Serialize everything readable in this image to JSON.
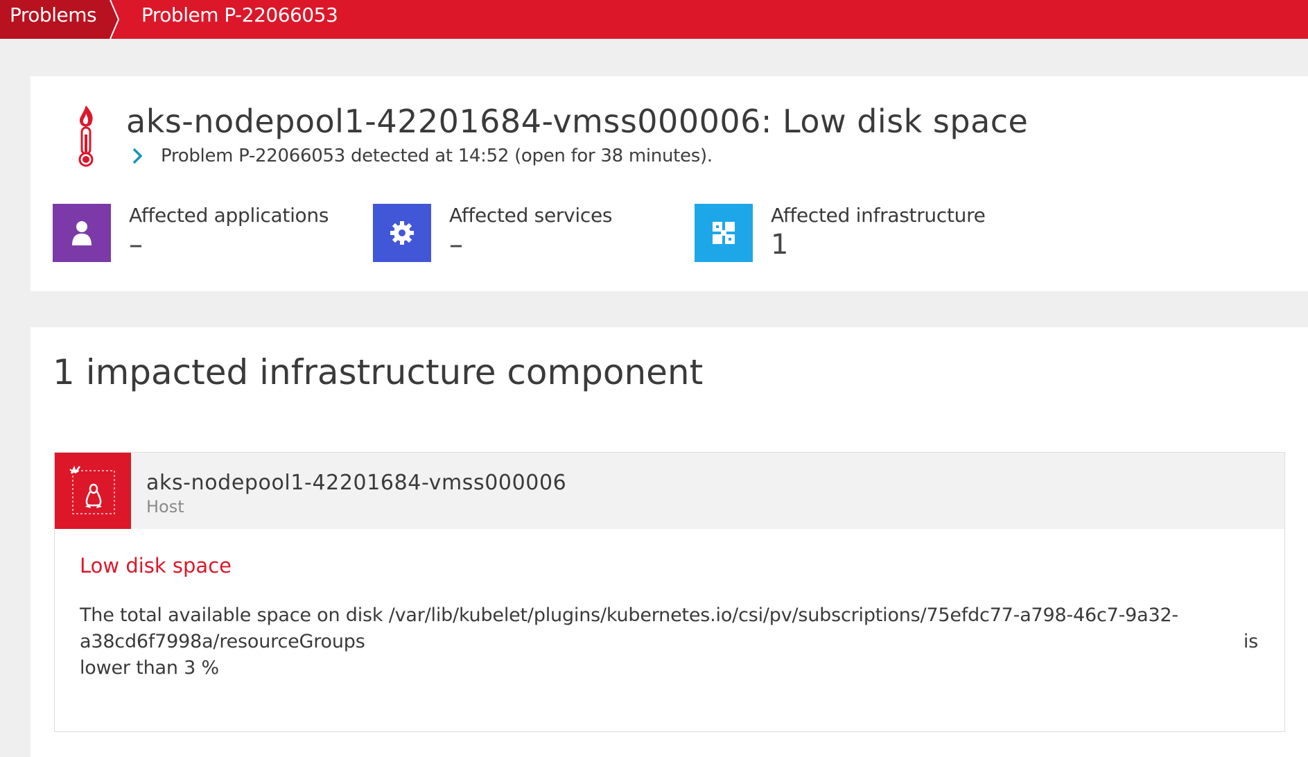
{
  "breadcrumb": {
    "items": [
      "Problems",
      "Problem P-22066053"
    ]
  },
  "problem": {
    "title": "aks-nodepool1-42201684-vmss000006: Low disk space",
    "subline": "Problem P-22066053 detected at 14:52 (open for 38 minutes).",
    "icon": "thermometer-fire-icon"
  },
  "affected": [
    {
      "label": "Affected applications",
      "value": "–",
      "icon": "user-icon",
      "color": "#7b3aa8"
    },
    {
      "label": "Affected services",
      "value": "–",
      "icon": "gear-icon",
      "color": "#4257d8"
    },
    {
      "label": "Affected infrastructure",
      "value": "1",
      "icon": "infrastructure-icon",
      "color": "#1ea7e8"
    }
  ],
  "impact": {
    "title": "1 impacted infrastructure component",
    "component": {
      "name": "aks-nodepool1-42201684-vmss000006",
      "type": "Host",
      "icon": "linux-host-icon",
      "event_title": "Low disk space",
      "description_lines": [
        "The total available space on disk /var/lib/kubelet/plugins/kubernetes.io/csi/pv/subscriptions/75efdc77-a798-46c7-9a32-",
        "a38cd6f7998a/resourceGroups",
        "lower than 3 %"
      ],
      "description_tail": "is"
    }
  },
  "colors": {
    "brand_red": "#dc172a",
    "breadcrumb_dark": "#b8111f"
  }
}
